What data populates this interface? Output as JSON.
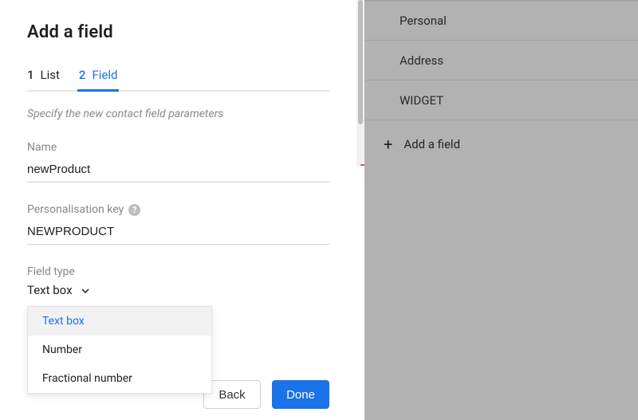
{
  "dialog": {
    "title": "Add a field",
    "subtitle": "Specify the new contact field parameters",
    "tabs": [
      {
        "num": "1",
        "label": "List"
      },
      {
        "num": "2",
        "label": "Field"
      }
    ],
    "active_tab_index": 1,
    "name_label": "Name",
    "name_value": "newProduct",
    "key_label": "Personalisation key",
    "key_value": "NEWPRODUCT",
    "type_label": "Field type",
    "type_value": "Text box",
    "type_options": [
      "Text box",
      "Number",
      "Fractional number"
    ],
    "type_selected_index": 0,
    "back_label": "Back",
    "done_label": "Done"
  },
  "background": {
    "rows": [
      "Personal",
      "Address",
      "WIDGET"
    ],
    "add_label": "Add a field"
  }
}
